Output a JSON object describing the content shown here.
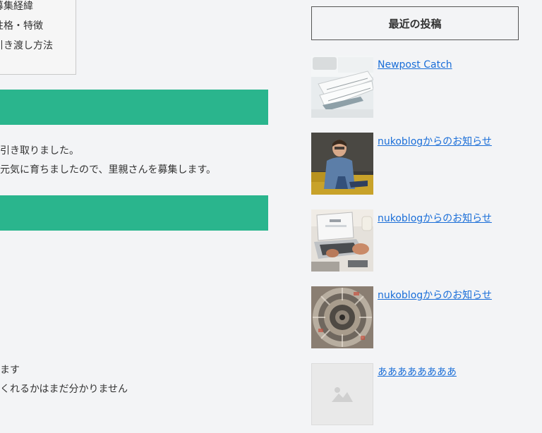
{
  "toc": {
    "items": [
      "募集経緯",
      "性格・特徴",
      "引き渡し方法"
    ]
  },
  "content": {
    "paragraphs": [
      "引き取りました。",
      "元気に育ちましたので、里親さんを募集します。",
      "ます",
      "くれるかはまだ分かりません"
    ]
  },
  "sidebar": {
    "widget_title": "最近の投稿",
    "posts": [
      {
        "title": "Newpost Catch",
        "thumb": "notebook-desk-photo"
      },
      {
        "title": "nukoblogからのお知らせ",
        "thumb": "man-on-sofa-photo"
      },
      {
        "title": "nukoblogからのお知らせ",
        "thumb": "laptop-typing-photo"
      },
      {
        "title": "nukoblogからのお知らせ",
        "thumb": "books-spiral-photo"
      },
      {
        "title": "ああああああああ",
        "thumb": "image-placeholder-icon"
      }
    ]
  },
  "colors": {
    "heading_bar": "#2ab58d",
    "link": "#1a6ed8",
    "background": "#f3f4f6"
  }
}
